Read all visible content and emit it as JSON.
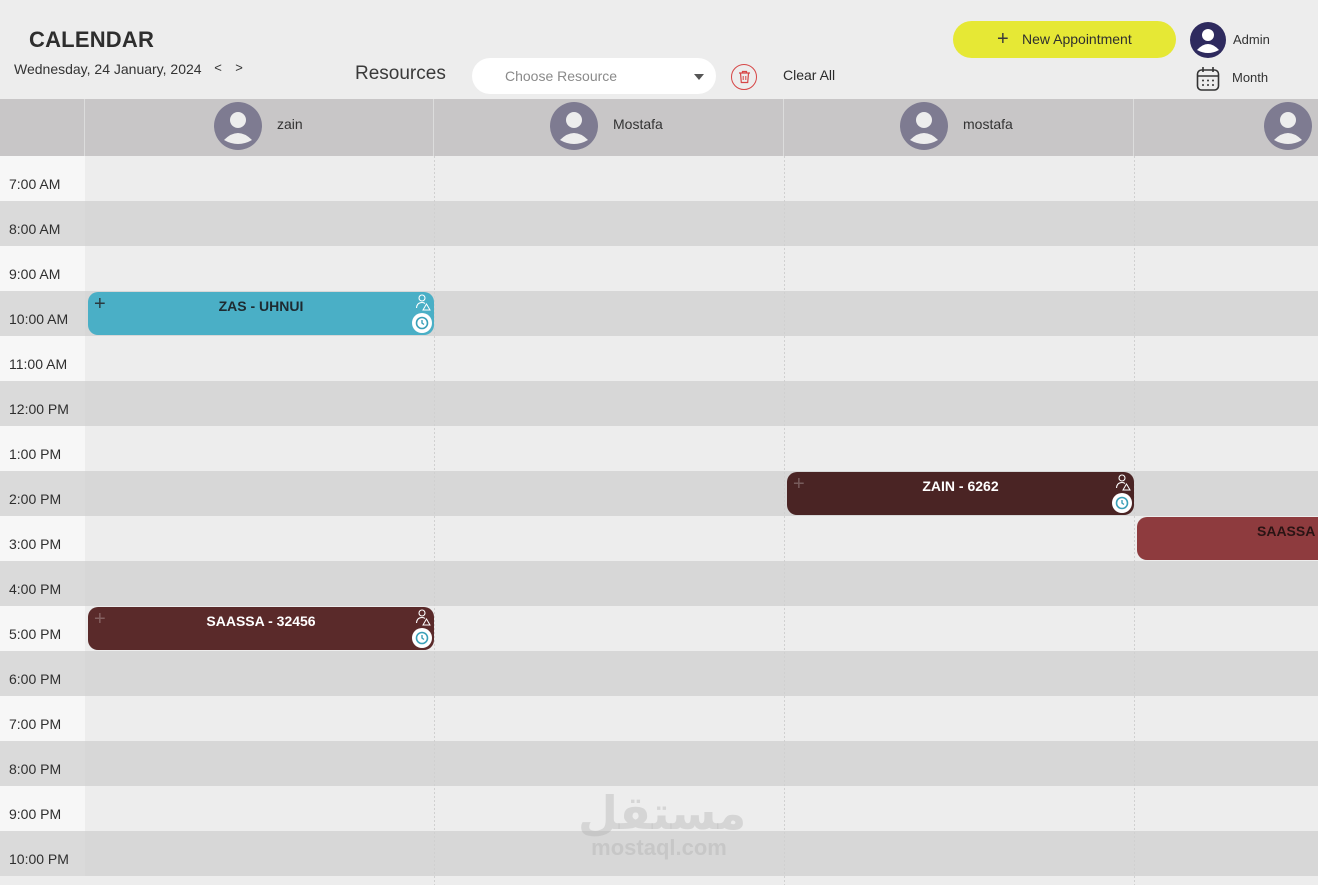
{
  "header": {
    "title": "CALENDAR",
    "date": "Wednesday, 24 January, 2024",
    "prev": "<",
    "next": ">",
    "resources_label": "Resources",
    "resource_placeholder": "Choose Resource",
    "clear_all": "Clear All",
    "new_appointment": "New Appointment",
    "user": "Admin",
    "view": "Month"
  },
  "resources": [
    {
      "name": "zain"
    },
    {
      "name": "Mostafa"
    },
    {
      "name": "mostafa"
    },
    {
      "name": ""
    }
  ],
  "times": [
    "7:00 AM",
    "8:00 AM",
    "9:00 AM",
    "10:00 AM",
    "11:00 AM",
    "12:00 PM",
    "1:00 PM",
    "2:00 PM",
    "3:00 PM",
    "4:00 PM",
    "5:00 PM",
    "6:00 PM",
    "7:00 PM",
    "8:00 PM",
    "9:00 PM",
    "10:00 PM"
  ],
  "events": [
    {
      "title": "ZAS - UHNUI",
      "resource": 0,
      "start": "10:00 AM",
      "color": "#4aafc6",
      "text_color": "#1e2a30"
    },
    {
      "title": "ZAIN - 6262",
      "resource": 2,
      "start": "2:00 PM",
      "color": "#4a2424",
      "text_color": "#ffffff"
    },
    {
      "title": "SAASSA - ",
      "resource": 3,
      "start": "3:00 PM",
      "color": "#8e3b3e",
      "text_color": "#2a1414"
    },
    {
      "title": "SAASSA - 32456",
      "resource": 0,
      "start": "5:00 PM",
      "color": "#5a2a2a",
      "text_color": "#ffffff"
    }
  ],
  "colors": {
    "accent": "#e6e835",
    "avatar": "#7e7b91",
    "admin_avatar": "#2e2a5e",
    "danger": "#d64545"
  },
  "watermark": {
    "arabic": "مستقل",
    "latin": "mostaql.com"
  }
}
